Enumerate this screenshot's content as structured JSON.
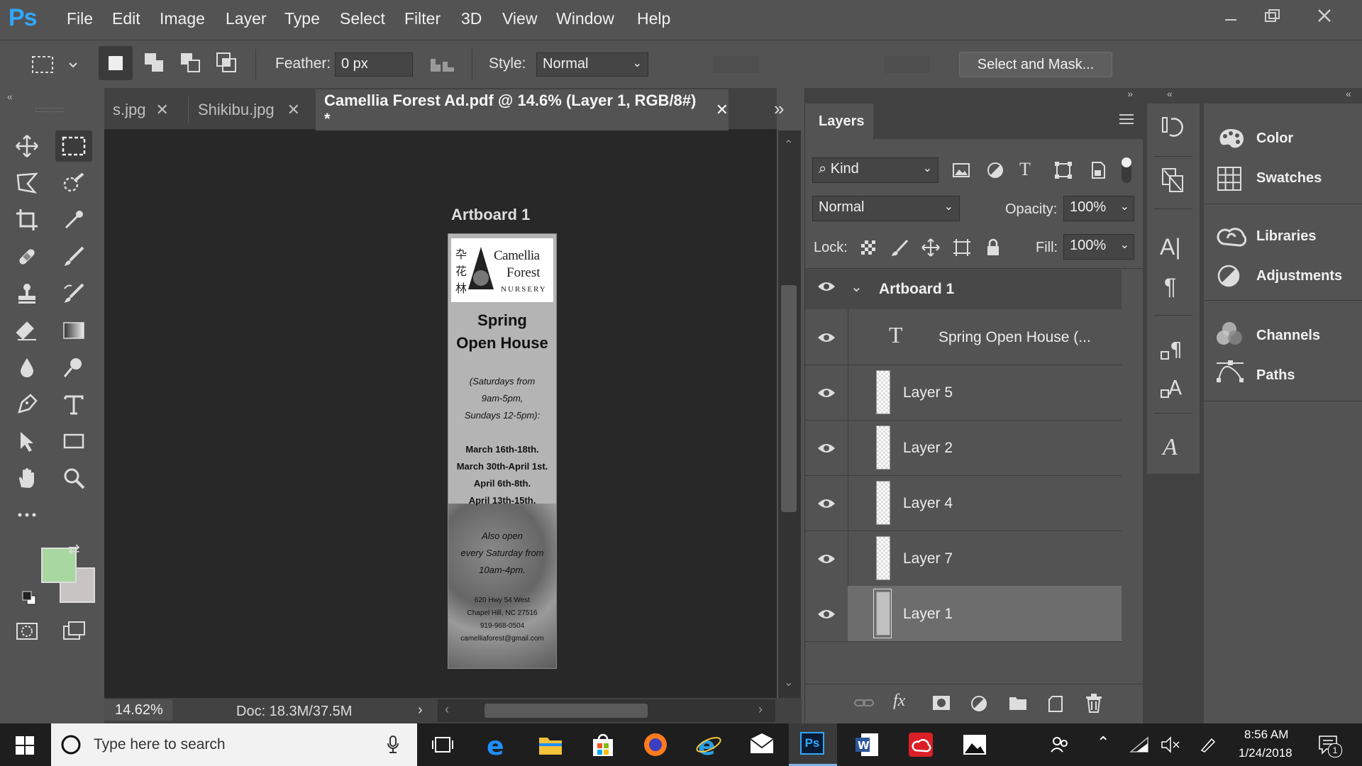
{
  "app": {
    "logo": "Ps"
  },
  "menu": [
    "File",
    "Edit",
    "Image",
    "Layer",
    "Type",
    "Select",
    "Filter",
    "3D",
    "View",
    "Window",
    "Help"
  ],
  "options": {
    "feather_label": "Feather:",
    "feather_value": "0 px",
    "style_label": "Style:",
    "style_value": "Normal",
    "select_mask": "Select and Mask..."
  },
  "tabs": [
    {
      "label": "s.jpg"
    },
    {
      "label": "Shikibu.jpg"
    },
    {
      "label": "Camellia Forest Ad.pdf @ 14.6% (Layer 1, RGB/8#) *"
    }
  ],
  "canvas": {
    "artboard_label": "Artboard 1",
    "doc": {
      "logo_title1": "Camellia",
      "logo_title2": "Forest",
      "logo_title3": "NURSERY",
      "heading1": "Spring",
      "heading2": "Open House",
      "times1": "(Saturdays from",
      "times2": "9am-5pm,",
      "times3": "Sundays 12-5pm):",
      "dates1": "March 16th-18th.",
      "dates2": "March 30th-April 1st.",
      "dates3": "April 6th-8th.",
      "dates4": "April 13th-15th.",
      "also1": "Also open",
      "also2": "every Saturday from",
      "also3": "10am-4pm.",
      "addr1": "620 Hwy 54 West",
      "addr2": "Chapel Hill, NC 27516",
      "addr3": "919-968-0504",
      "addr4": "camelliaforest@gmail.com"
    }
  },
  "status": {
    "zoom": "14.62%",
    "doc": "Doc: 18.3M/37.5M"
  },
  "layers_panel": {
    "tab": "Layers",
    "filter": "Kind",
    "blend": "Normal",
    "opacity_label": "Opacity:",
    "opacity": "100%",
    "lock_label": "Lock:",
    "fill_label": "Fill:",
    "fill": "100%",
    "artboard": "Artboard 1",
    "layers": [
      {
        "name": "Spring  Open House  (..."
      },
      {
        "name": "Layer 5"
      },
      {
        "name": "Layer 2"
      },
      {
        "name": "Layer 4"
      },
      {
        "name": "Layer 7"
      },
      {
        "name": "Layer 1"
      }
    ]
  },
  "right_panels": [
    "Color",
    "Swatches",
    "Libraries",
    "Adjustments",
    "Channels",
    "Paths"
  ],
  "colors": {
    "foreground": "#a8d8a0",
    "background": "#c8c4c4",
    "accent": "#31a8ff"
  },
  "taskbar": {
    "search_placeholder": "Type here to search",
    "time": "8:56 AM",
    "date": "1/24/2018",
    "notifications": "1"
  }
}
